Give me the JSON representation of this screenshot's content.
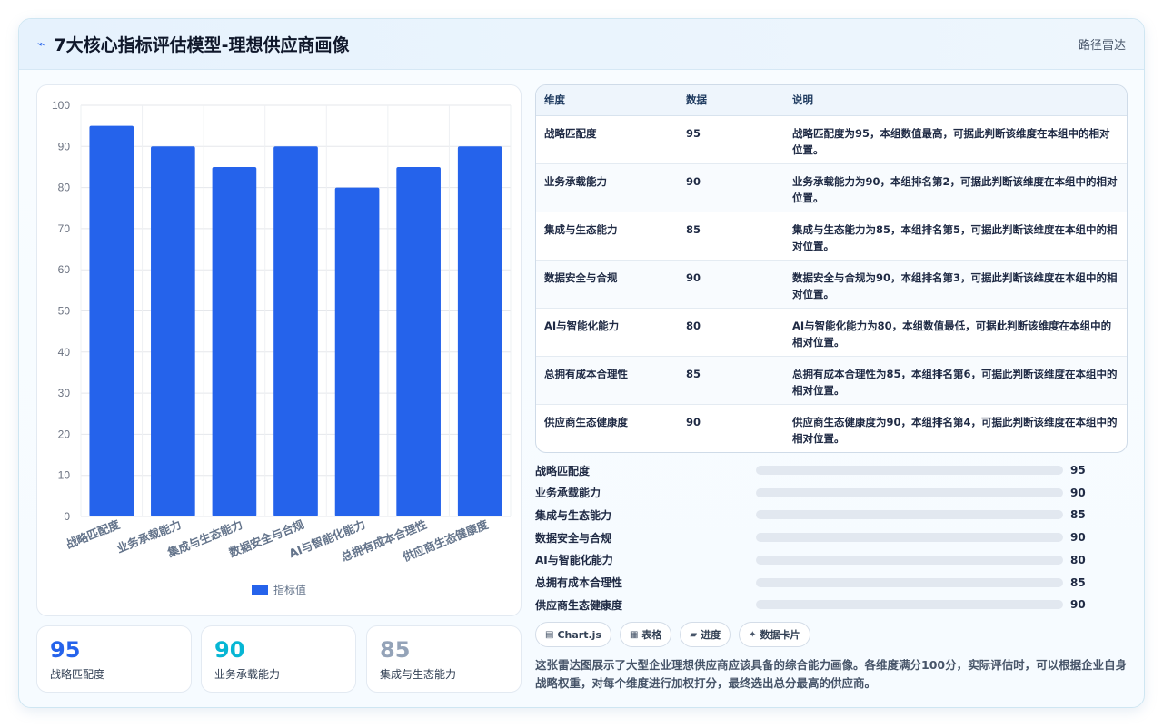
{
  "header": {
    "title": "7大核心指标评估模型-理想供应商画像",
    "tag": "路径雷达"
  },
  "chart_data": {
    "type": "bar",
    "categories": [
      "战略匹配度",
      "业务承载能力",
      "集成与生态能力",
      "数据安全与合规",
      "AI与智能化能力",
      "总拥有成本合理性",
      "供应商生态健康度"
    ],
    "series": [
      {
        "name": "指标值",
        "values": [
          95,
          90,
          85,
          90,
          80,
          85,
          90
        ]
      }
    ],
    "ylim": [
      0,
      100
    ],
    "yticks": [
      0,
      10,
      20,
      30,
      40,
      50,
      60,
      70,
      80,
      90,
      100
    ],
    "grid": true,
    "legend": "bottom",
    "bar_color": "#2563eb"
  },
  "stats": [
    {
      "value": "95",
      "label": "战略匹配度",
      "color": "#2563eb"
    },
    {
      "value": "90",
      "label": "业务承载能力",
      "color": "#06b6d4"
    },
    {
      "value": "85",
      "label": "集成与生态能力",
      "color": "#94a3b8"
    }
  ],
  "table": {
    "headers": [
      "维度",
      "数据",
      "说明"
    ],
    "rows": [
      {
        "dim": "战略匹配度",
        "val": "95",
        "note": "战略匹配度为95，本组数值最高，可据此判断该维度在本组中的相对位置。"
      },
      {
        "dim": "业务承载能力",
        "val": "90",
        "note": "业务承载能力为90，本组排名第2，可据此判断该维度在本组中的相对位置。"
      },
      {
        "dim": "集成与生态能力",
        "val": "85",
        "note": "集成与生态能力为85，本组排名第5，可据此判断该维度在本组中的相对位置。"
      },
      {
        "dim": "数据安全与合规",
        "val": "90",
        "note": "数据安全与合规为90，本组排名第3，可据此判断该维度在本组中的相对位置。"
      },
      {
        "dim": "AI与智能化能力",
        "val": "80",
        "note": "AI与智能化能力为80，本组数值最低，可据此判断该维度在本组中的相对位置。"
      },
      {
        "dim": "总拥有成本合理性",
        "val": "85",
        "note": "总拥有成本合理性为85，本组排名第6，可据此判断该维度在本组中的相对位置。"
      },
      {
        "dim": "供应商生态健康度",
        "val": "90",
        "note": "供应商生态健康度为90，本组排名第4，可据此判断该维度在本组中的相对位置。"
      }
    ]
  },
  "progress": [
    {
      "label": "战略匹配度",
      "value": 95
    },
    {
      "label": "业务承载能力",
      "value": 90
    },
    {
      "label": "集成与生态能力",
      "value": 85
    },
    {
      "label": "数据安全与合规",
      "value": 90
    },
    {
      "label": "AI与智能化能力",
      "value": 80
    },
    {
      "label": "总拥有成本合理性",
      "value": 85
    },
    {
      "label": "供应商生态健康度",
      "value": 90
    }
  ],
  "pills": [
    {
      "icon": "▤",
      "label": "Chart.js"
    },
    {
      "icon": "▦",
      "label": "表格"
    },
    {
      "icon": "▰",
      "label": "进度"
    },
    {
      "icon": "✦",
      "label": "数据卡片"
    }
  ],
  "description": "这张雷达图展示了大型企业理想供应商应该具备的综合能力画像。各维度满分100分，实际评估时，可以根据企业自身战略权重，对每个维度进行加权打分，最终选出总分最高的供应商。"
}
